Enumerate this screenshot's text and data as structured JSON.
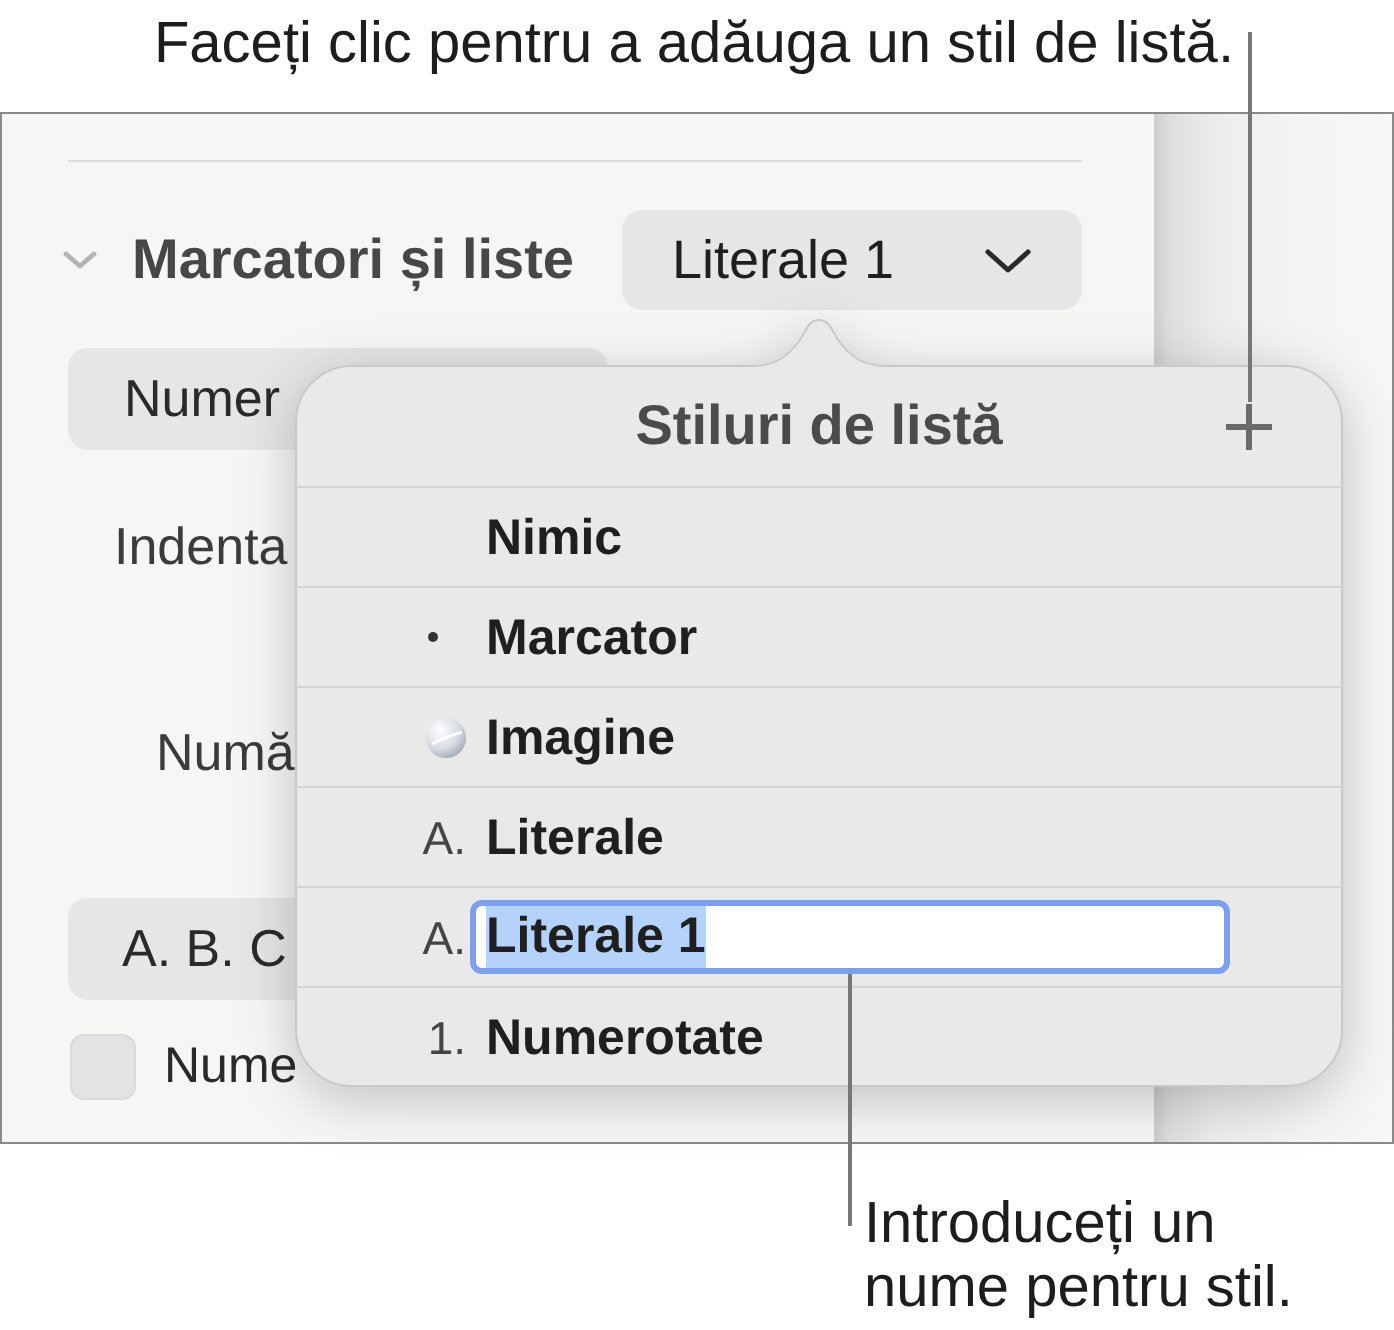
{
  "top_callout": "Faceți clic pentru a adăuga un stil de listă.",
  "inspector": {
    "section": {
      "title": "Marcatori și liste",
      "expanded": true
    },
    "style_popup": {
      "value": "Literale 1"
    },
    "field_1": {
      "value": "Numer"
    },
    "label_1": "Indenta",
    "label_2": "Numă",
    "field_2": {
      "value": "A. B. C"
    },
    "checkbox": {
      "label": "Nume",
      "checked": false
    }
  },
  "popover": {
    "title": "Stiluri de listă",
    "items": [
      {
        "kind": "none",
        "label": "Nimic",
        "editing": false
      },
      {
        "kind": "bullet",
        "label": "Marcator",
        "editing": false
      },
      {
        "kind": "image",
        "label": "Imagine",
        "editing": false
      },
      {
        "kind": "text",
        "marker": "A.",
        "label": "Literale",
        "editing": false
      },
      {
        "kind": "text",
        "marker": "A.",
        "label": "Literale 1",
        "editing": true
      },
      {
        "kind": "text",
        "marker": "1.",
        "label": "Numerotate",
        "editing": false
      }
    ]
  },
  "bottom_callout": "Introduceți un\nnume pentru stil."
}
